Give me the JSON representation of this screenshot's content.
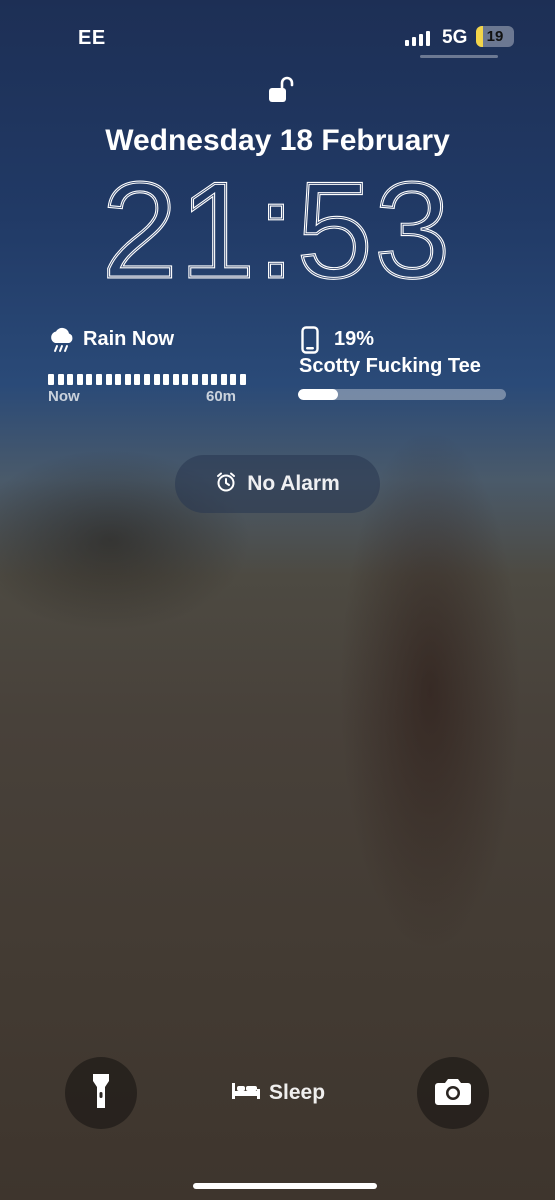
{
  "status_bar": {
    "carrier": "EE",
    "network": "5G",
    "battery_percent": "19",
    "battery_level": 0.19,
    "battery_color": "#f3d54a"
  },
  "lock_screen": {
    "lock_icon": "unlocked-padlock-icon",
    "date": "Wednesday 18 February",
    "time": "21:53"
  },
  "weather_widget": {
    "icon": "rain-cloud-icon",
    "title": "Rain Now",
    "start_label": "Now",
    "end_label": "60m"
  },
  "battery_widget": {
    "icon": "phone-icon",
    "percent": "19%",
    "device_name": "Scotty Fucking Tee",
    "level": 0.19
  },
  "alarm": {
    "icon": "alarm-clock-icon",
    "label": "No Alarm"
  },
  "bottom_controls": {
    "flashlight_icon": "flashlight-icon",
    "sleep_icon": "bed-icon",
    "sleep_label": "Sleep",
    "camera_icon": "camera-icon"
  }
}
